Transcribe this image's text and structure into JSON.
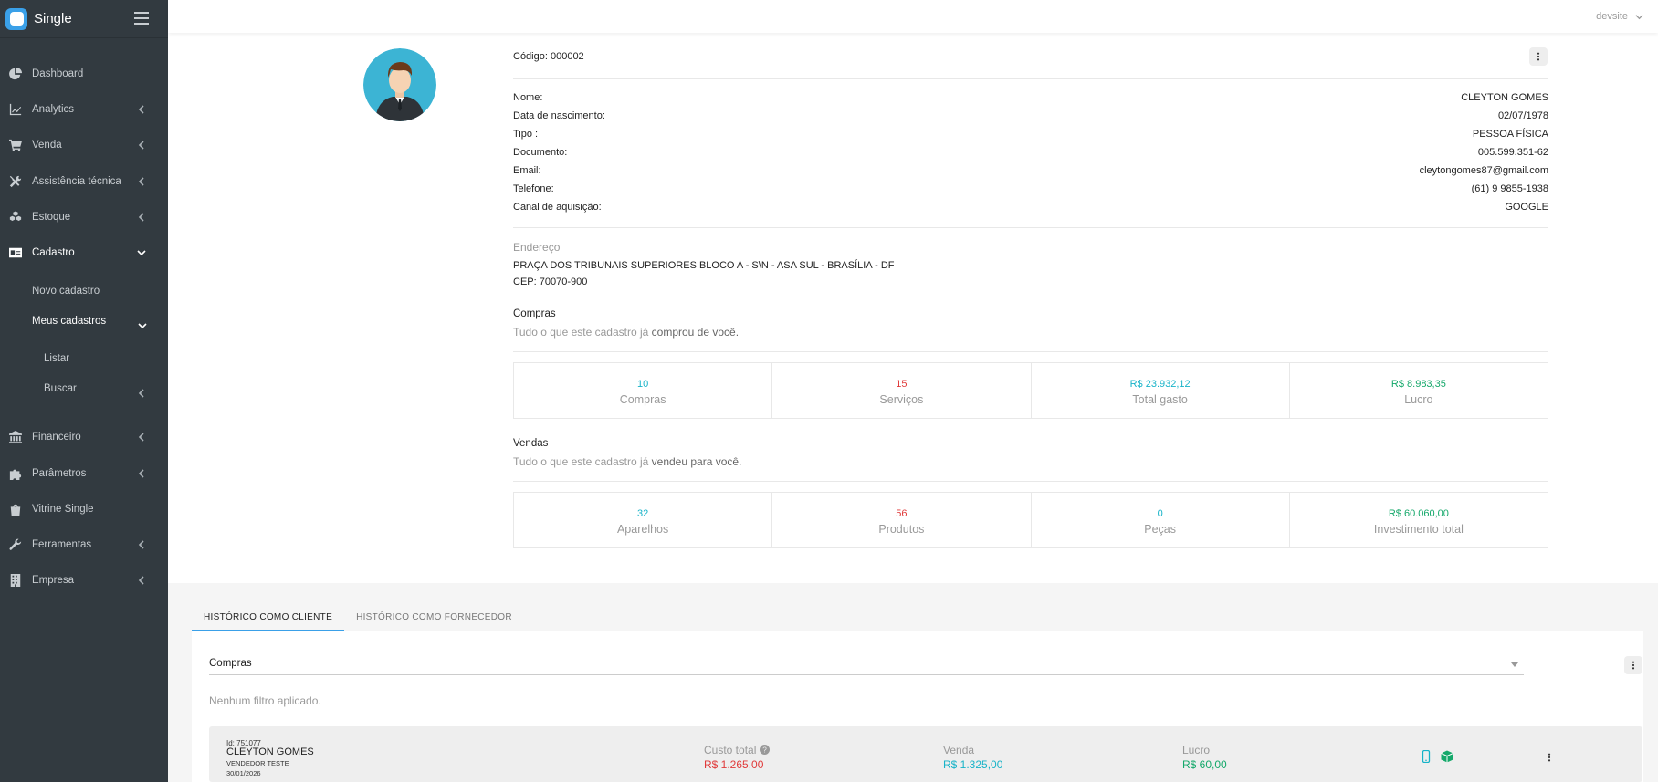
{
  "app": {
    "name": "Single"
  },
  "header": {
    "user": "devsite"
  },
  "sidebar": {
    "items": [
      {
        "label": "Dashboard",
        "icon": "pie-chart-icon"
      },
      {
        "label": "Analytics",
        "icon": "line-chart-icon"
      },
      {
        "label": "Venda",
        "icon": "cart-icon"
      },
      {
        "label": "Assistência técnica",
        "icon": "tools-icon"
      },
      {
        "label": "Estoque",
        "icon": "cubes-icon"
      },
      {
        "label": "Cadastro",
        "icon": "id-card-icon"
      },
      {
        "label": "Financeiro",
        "icon": "bank-icon"
      },
      {
        "label": "Parâmetros",
        "icon": "puzzle-icon"
      },
      {
        "label": "Vitrine Single",
        "icon": "bag-icon"
      },
      {
        "label": "Ferramentas",
        "icon": "wrench-icon"
      },
      {
        "label": "Empresa",
        "icon": "building-icon"
      }
    ],
    "sub": {
      "novo": "Novo cadastro",
      "meus": "Meus cadastros",
      "listar": "Listar",
      "buscar": "Buscar"
    }
  },
  "profile": {
    "codigo": "Código: 000002",
    "fields": [
      {
        "label": "Nome:",
        "value": "CLEYTON GOMES"
      },
      {
        "label": "Data de nascimento:",
        "value": "02/07/1978"
      },
      {
        "label": "Tipo :",
        "value": "PESSOA FÍSICA"
      },
      {
        "label": "Documento:",
        "value": "005.599.351-62"
      },
      {
        "label": "Email:",
        "value": "cleytongomes87@gmail.com"
      },
      {
        "label": "Telefone:",
        "value": "(61) 9 9855-1938"
      },
      {
        "label": "Canal de aquisição:",
        "value": "GOOGLE"
      }
    ],
    "endereco_title": "Endereço",
    "endereco_line1": "PRAÇA DOS TRIBUNAIS SUPERIORES BLOCO A - S\\N - ASA SUL - BRASÍLIA - DF",
    "endereco_line2": "CEP: 70070-900"
  },
  "compras": {
    "title": "Compras",
    "sub_prefix": "Tudo o que este cadastro já ",
    "sub_bold": "comprou de você.",
    "stats": [
      {
        "value": "10",
        "label": "Compras",
        "color": "#17b3c8"
      },
      {
        "value": "15",
        "label": "Serviços",
        "color": "#e03a3a"
      },
      {
        "value": "R$ 23.932,12",
        "label": "Total gasto",
        "color": "#17b3c8"
      },
      {
        "value": "R$ 8.983,35",
        "label": "Lucro",
        "color": "#14a86a"
      }
    ]
  },
  "vendas": {
    "title": "Vendas",
    "sub_prefix": "Tudo o que este cadastro já ",
    "sub_bold": "vendeu para você.",
    "stats": [
      {
        "value": "32",
        "label": "Aparelhos",
        "color": "#17b3c8"
      },
      {
        "value": "56",
        "label": "Produtos",
        "color": "#e03a3a"
      },
      {
        "value": "0",
        "label": "Peças",
        "color": "#17b3c8"
      },
      {
        "value": "R$ 60.060,00",
        "label": "Investimento total",
        "color": "#14a86a"
      }
    ]
  },
  "tabs": [
    {
      "label": "HISTÓRICO COMO CLIENTE",
      "active": true
    },
    {
      "label": "HISTÓRICO COMO FORNECEDOR",
      "active": false
    }
  ],
  "filter": {
    "select_value": "Compras",
    "no_filter": "Nenhum filtro aplicado."
  },
  "order": {
    "id": "Id: 751077",
    "name": "CLEYTON GOMES",
    "seller": "VENDEDOR TESTE",
    "date": "30/01/2026",
    "custo_label": "Custo total",
    "custo_value": "R$ 1.265,00",
    "venda_label": "Venda",
    "venda_value": "R$ 1.325,00",
    "lucro_label": "Lucro",
    "lucro_value": "R$ 60,00"
  }
}
